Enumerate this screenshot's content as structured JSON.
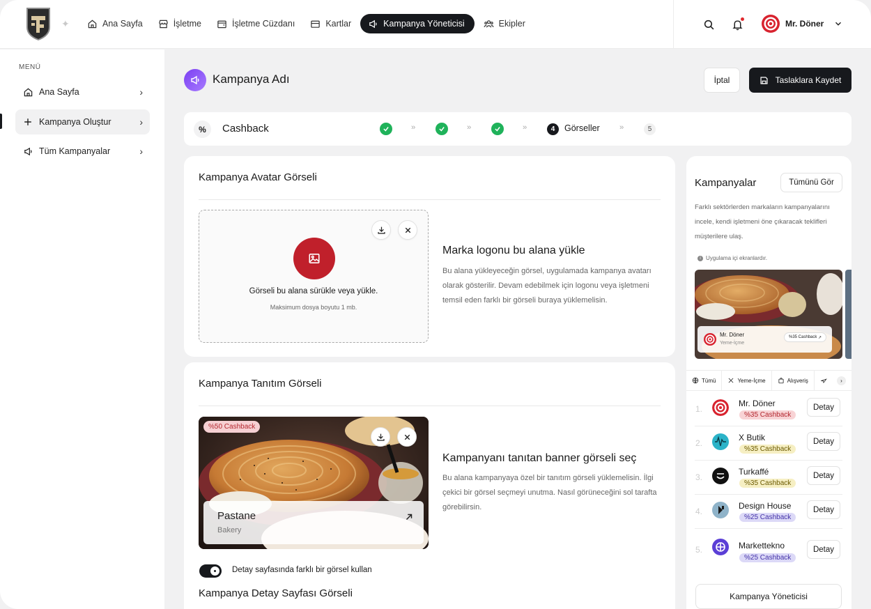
{
  "nav": {
    "items": [
      {
        "label": "Ana Sayfa",
        "icon": "home-icon"
      },
      {
        "label": "İşletme",
        "icon": "store-icon"
      },
      {
        "label": "İşletme Cüzdanı",
        "icon": "wallet-icon"
      },
      {
        "label": "Kartlar",
        "icon": "card-icon"
      },
      {
        "label": "Kampanya Yöneticisi",
        "icon": "megaphone-icon",
        "active": true
      },
      {
        "label": "Ekipler",
        "icon": "team-icon"
      }
    ],
    "user_name": "Mr. Döner"
  },
  "sidebar": {
    "menu_title": "MENÜ",
    "items": [
      {
        "label": "Ana Sayfa",
        "icon": "home-icon"
      },
      {
        "label": "Kampanya Oluştur",
        "icon": "plus-icon",
        "active": true
      },
      {
        "label": "Tüm Kampanyalar",
        "icon": "megaphone-icon"
      }
    ]
  },
  "header": {
    "title": "Kampanya Adı",
    "cancel_label": "İptal",
    "save_label": "Taslaklara Kaydet"
  },
  "stepper": {
    "type_label": "Cashback",
    "type_symbol": "%",
    "current_step_number": "4",
    "current_step_label": "Görseller",
    "last_step_number": "5",
    "completed_steps": 3
  },
  "avatar_section": {
    "title": "Kampanya Avatar Görseli",
    "dropzone_title": "Görseli bu alana sürükle veya yükle.",
    "dropzone_sub": "Maksimum dosya boyutu 1 mb.",
    "info_title": "Marka logonu bu alana yükle",
    "info_text": "Bu alana yükleyeceğin görsel, uygulamada kampanya avatarı olarak gösterilir. Devam edebilmek için logonu veya işletmeni temsil eden farklı bir görseli buraya yüklemelisin."
  },
  "banner_section": {
    "title": "Kampanya Tanıtım Görseli",
    "badge": "%50 Cashback",
    "banner_name": "Pastane",
    "banner_category": "Bakery",
    "info_title": "Kampanyanı tanıtan banner görseli seç",
    "info_text": "Bu alana kampanyaya özel bir tanıtım görseli yüklemelisin. İlgi çekici bir görsel seçmeyi unutma. Nasıl görüneceğini sol tarafta görebilirsin.",
    "toggle_label": "Detay sayfasında farklı bir görsel kullan",
    "toggle_on": true,
    "detail_title": "Kampanya Detay Sayfası Görseli"
  },
  "right_panel": {
    "title": "Kampanyalar",
    "view_all_label": "Tümünü Gör",
    "description": "Farklı sektörlerden markaların kampanyalarını incele, kendi işletmeni öne çıkaracak teklifleri müşterilere ulaş.",
    "note": "Uygulama içi ekranlardır.",
    "preview": {
      "name": "Mr. Döner",
      "category": "Yeme-İçme",
      "button": "%35 Cashback"
    },
    "tabs": [
      "Tümü",
      "Yeme-İçme",
      "Alışveriş"
    ],
    "ranking": [
      {
        "rank": "1.",
        "name": "Mr. Döner",
        "badge": "%35 Cashback",
        "badge_color": "#f8d3d5",
        "badge_text": "#b3262e",
        "action": "Detay"
      },
      {
        "rank": "2.",
        "name": "X Butik",
        "badge": "%35 Cashback",
        "badge_color": "#f6efc3",
        "badge_text": "#6b5a00",
        "action": "Detay"
      },
      {
        "rank": "3.",
        "name": "Turkaffé",
        "badge": "%35 Cashback",
        "badge_color": "#f6efc3",
        "badge_text": "#6b5a00",
        "action": "Detay"
      },
      {
        "rank": "4.",
        "name": "Design House",
        "badge": "%25 Cashback",
        "badge_color": "#dcd9f7",
        "badge_text": "#4433a8",
        "action": "Detay"
      },
      {
        "rank": "5.",
        "name": "Markettekno",
        "badge": "%25 Cashback",
        "badge_color": "#dcd9f7",
        "badge_text": "#4433a8",
        "action": "Detay"
      }
    ],
    "manager_label": "Kampanya Yöneticisi"
  },
  "colors": {
    "accent_dark": "#17191d",
    "brand_red": "#c0202b",
    "success_green": "#1fb25a",
    "purple": "#7b3ff2"
  }
}
